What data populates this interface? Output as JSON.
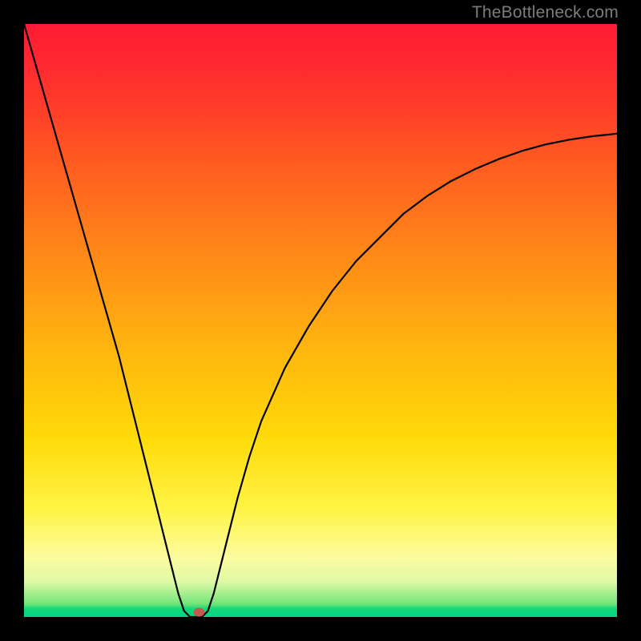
{
  "watermark": "TheBottleneck.com",
  "chart_data": {
    "type": "line",
    "title": "",
    "xlabel": "",
    "ylabel": "",
    "xlim": [
      0,
      100
    ],
    "ylim": [
      0,
      100
    ],
    "grid": false,
    "legend": false,
    "series": [
      {
        "name": "bottleneck-curve",
        "x": [
          0,
          2,
          4,
          6,
          8,
          10,
          12,
          14,
          16,
          18,
          20,
          22,
          24,
          26,
          27,
          28,
          29,
          30,
          31,
          32,
          34,
          36,
          38,
          40,
          44,
          48,
          52,
          56,
          60,
          64,
          68,
          72,
          76,
          80,
          84,
          88,
          92,
          96,
          100
        ],
        "y": [
          100,
          93,
          86,
          79,
          72,
          65,
          58,
          51,
          44,
          36,
          28,
          20,
          12,
          4,
          1,
          0,
          0,
          0,
          1,
          4,
          12,
          20,
          27,
          33,
          42,
          49,
          55,
          60,
          64,
          68,
          71,
          73.5,
          75.5,
          77.2,
          78.6,
          79.7,
          80.5,
          81.1,
          81.5
        ]
      }
    ],
    "marker": {
      "name": "optimal-point",
      "x": 29.5,
      "y": 0.8,
      "color": "#c25a4f"
    },
    "background_gradient": {
      "orientation": "vertical",
      "stops": [
        {
          "pos": 0.0,
          "color": "#ff1a33"
        },
        {
          "pos": 0.3,
          "color": "#ff6f1d"
        },
        {
          "pos": 0.62,
          "color": "#ffc70c"
        },
        {
          "pos": 0.9,
          "color": "#fcfca0"
        },
        {
          "pos": 0.98,
          "color": "#14d977"
        },
        {
          "pos": 1.0,
          "color": "#00d588"
        }
      ]
    }
  }
}
